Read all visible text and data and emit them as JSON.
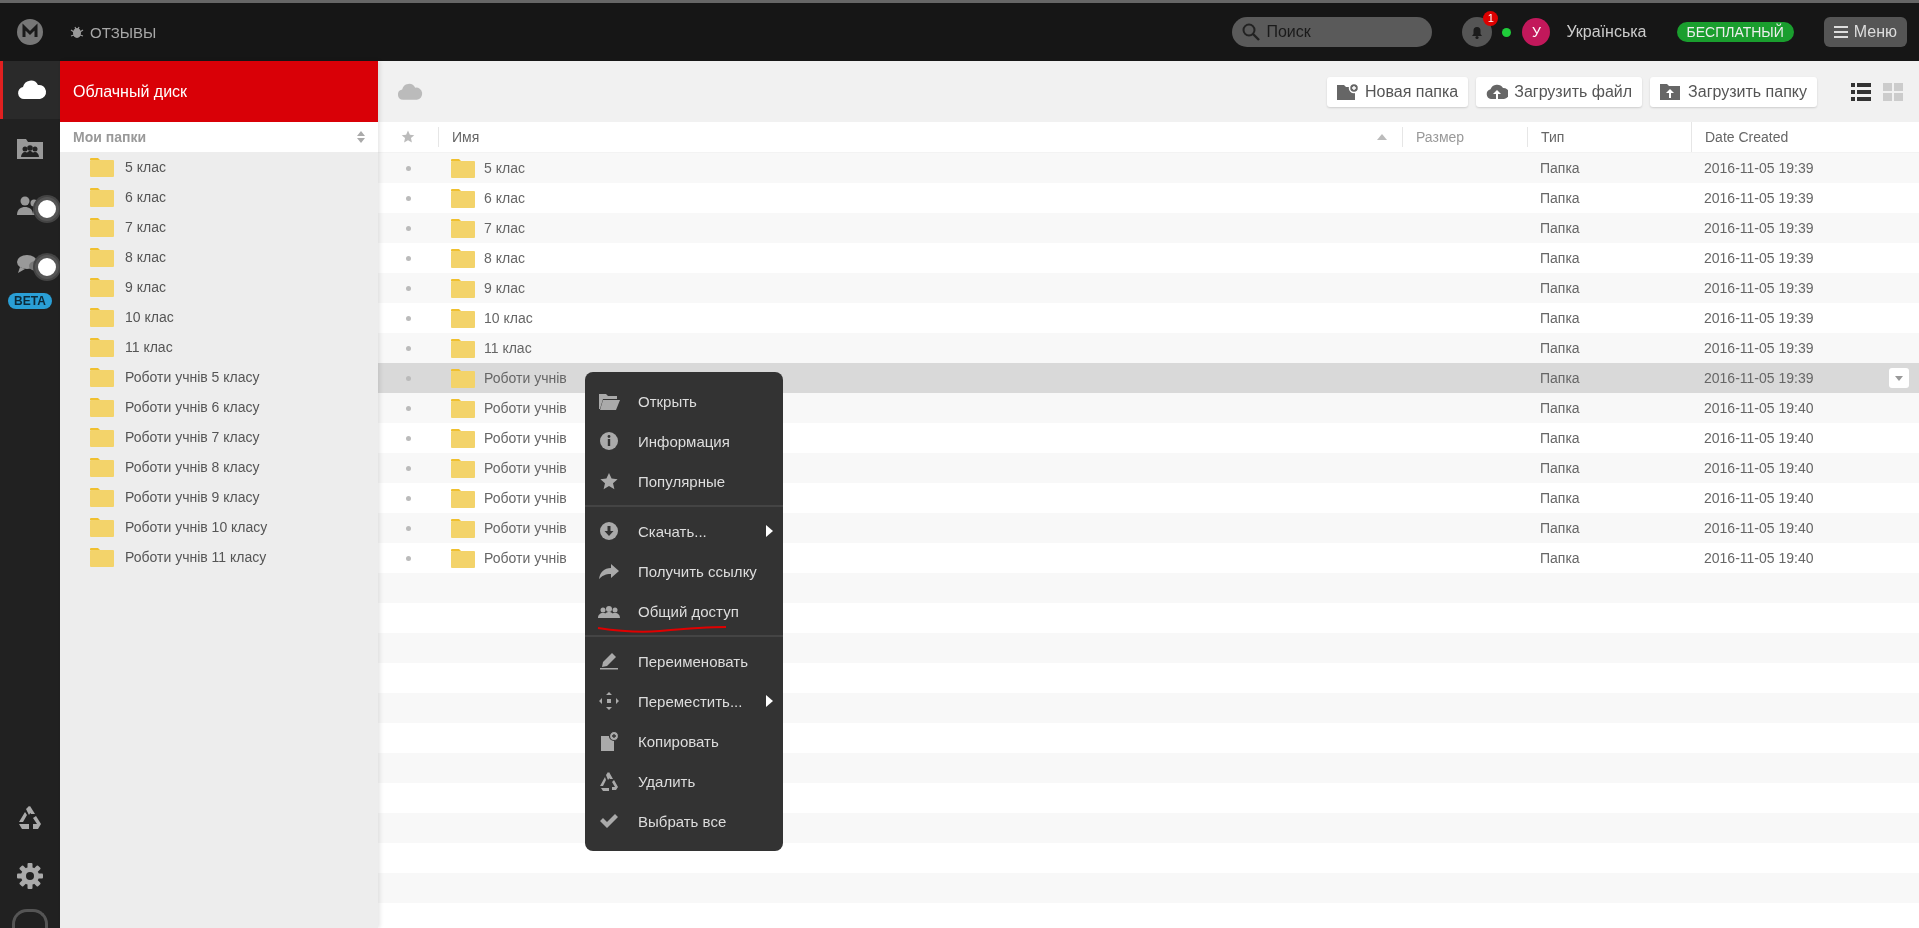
{
  "topbar": {
    "feedback": "ОТЗЫВЫ",
    "search_placeholder": "Поиск",
    "notification_count": "1",
    "avatar_letter": "У",
    "language": "Українська",
    "plan": "БЕСПЛАТНЫЙ",
    "menu": "Меню"
  },
  "rail": {
    "items": [
      {
        "selected": true
      },
      {
        "selected": false
      },
      {
        "selected": false
      },
      {
        "selected": false
      }
    ],
    "beta_badge": "BETA"
  },
  "sidebar": {
    "title": "Облачный диск",
    "section": "Мои папки",
    "folders": [
      {
        "name": "5 клас"
      },
      {
        "name": "6 клас"
      },
      {
        "name": "7 клас"
      },
      {
        "name": "8 клас"
      },
      {
        "name": "9 клас"
      },
      {
        "name": "10 клас"
      },
      {
        "name": "11 клас"
      },
      {
        "name": "Роботи учнів 5 класу"
      },
      {
        "name": "Роботи учнів 6 класу"
      },
      {
        "name": "Роботи учнів 7 класу"
      },
      {
        "name": "Роботи учнів 8 класу"
      },
      {
        "name": "Роботи учнів 9 класу"
      },
      {
        "name": "Роботи учнів 10 класу"
      },
      {
        "name": "Роботи учнів 11 класу"
      }
    ]
  },
  "toolbar": {
    "buttons": [
      "Новая папка",
      "Загрузить файл",
      "Загрузить папку"
    ],
    "views": [
      {
        "selected": true
      },
      {
        "selected": false
      }
    ]
  },
  "table": {
    "columns": [
      "Имя",
      "Размер",
      "Тип",
      "Date Created"
    ],
    "rows": [
      {
        "name": "5 клас",
        "type": "Папка",
        "date": "2016-11-05 19:39",
        "selected": false
      },
      {
        "name": "6 клас",
        "type": "Папка",
        "date": "2016-11-05 19:39",
        "selected": false
      },
      {
        "name": "7 клас",
        "type": "Папка",
        "date": "2016-11-05 19:39",
        "selected": false
      },
      {
        "name": "8 клас",
        "type": "Папка",
        "date": "2016-11-05 19:39",
        "selected": false
      },
      {
        "name": "9 клас",
        "type": "Папка",
        "date": "2016-11-05 19:39",
        "selected": false
      },
      {
        "name": "10 клас",
        "type": "Папка",
        "date": "2016-11-05 19:39",
        "selected": false
      },
      {
        "name": "11 клас",
        "type": "Папка",
        "date": "2016-11-05 19:39",
        "selected": false
      },
      {
        "name": "Роботи учнів",
        "type": "Папка",
        "date": "2016-11-05 19:39",
        "selected": true
      },
      {
        "name": "Роботи учнів",
        "type": "Папка",
        "date": "2016-11-05 19:40",
        "selected": false
      },
      {
        "name": "Роботи учнів",
        "type": "Папка",
        "date": "2016-11-05 19:40",
        "selected": false
      },
      {
        "name": "Роботи учнів",
        "type": "Папка",
        "date": "2016-11-05 19:40",
        "selected": false
      },
      {
        "name": "Роботи учнів",
        "type": "Папка",
        "date": "2016-11-05 19:40",
        "selected": false
      },
      {
        "name": "Роботи учнів",
        "type": "Папка",
        "date": "2016-11-05 19:40",
        "selected": false
      },
      {
        "name": "Роботи учнів",
        "type": "Папка",
        "date": "2016-11-05 19:40",
        "selected": false
      }
    ]
  },
  "context_menu": {
    "groups": [
      [
        {
          "label": "Открыть",
          "submenu": false,
          "annotated": false
        },
        {
          "label": "Информация",
          "submenu": false,
          "annotated": false
        },
        {
          "label": "Популярные",
          "submenu": false,
          "annotated": false
        }
      ],
      [
        {
          "label": "Скачать...",
          "submenu": true,
          "annotated": false
        },
        {
          "label": "Получить ссылку",
          "submenu": false,
          "annotated": false
        },
        {
          "label": "Общий доступ",
          "submenu": false,
          "annotated": true
        }
      ],
      [
        {
          "label": "Переименовать",
          "submenu": false,
          "annotated": false
        },
        {
          "label": "Переместить...",
          "submenu": true,
          "annotated": false
        },
        {
          "label": "Копировать",
          "submenu": false,
          "annotated": false
        },
        {
          "label": "Удалить",
          "submenu": false,
          "annotated": false
        },
        {
          "label": "Выбрать все",
          "submenu": false,
          "annotated": false
        }
      ]
    ]
  }
}
